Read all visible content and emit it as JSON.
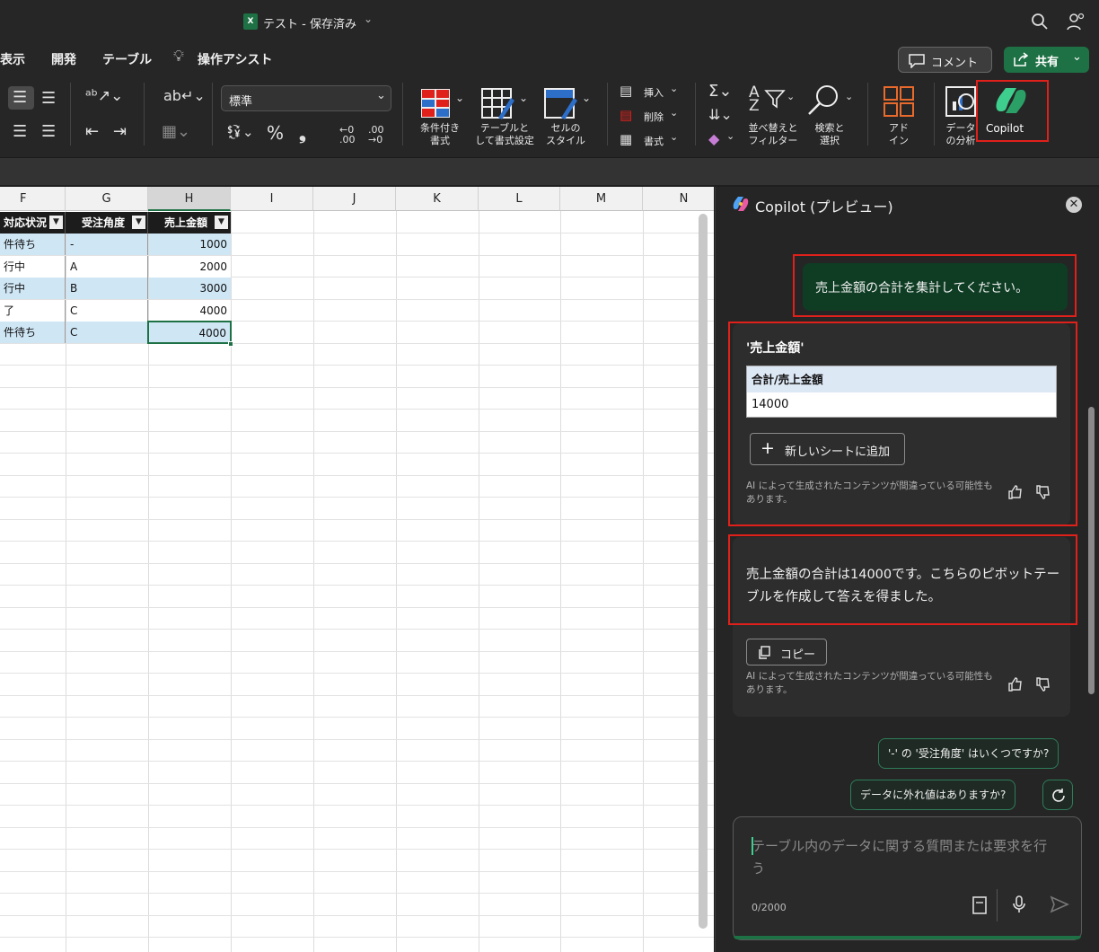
{
  "titlebar": {
    "doc_title": "テスト - 保存済み"
  },
  "menu": {
    "items": [
      "表示",
      "開発",
      "テーブル",
      "操作アシスト"
    ],
    "comment_label": "コメント",
    "share_label": "共有"
  },
  "ribbon": {
    "number_format": "標準",
    "conditional_format": [
      "条件付き",
      "書式"
    ],
    "format_as_table": [
      "テーブルと",
      "して書式設定"
    ],
    "cell_styles": [
      "セルの",
      "スタイル"
    ],
    "insert_label": "挿入",
    "delete_label": "削除",
    "format_label": "書式",
    "sort_filter": [
      "並べ替えと",
      "フィルター"
    ],
    "find_select": [
      "検索と",
      "選択"
    ],
    "addins": [
      "アド",
      "イン"
    ],
    "data_analysis": [
      "データ",
      "の分析"
    ],
    "copilot_label": "Copilot"
  },
  "sheet": {
    "columns": [
      "F",
      "G",
      "H",
      "I",
      "J",
      "K",
      "L",
      "M",
      "N"
    ],
    "headers": {
      "f": "対応状況",
      "g": "受注角度",
      "h": "売上金額"
    },
    "rows": [
      {
        "f": "件待ち",
        "g": "-",
        "h": "1000"
      },
      {
        "f": "行中",
        "g": "A",
        "h": "2000"
      },
      {
        "f": "行中",
        "g": "B",
        "h": "3000"
      },
      {
        "f": "了",
        "g": "C",
        "h": "4000"
      },
      {
        "f": "件待ち",
        "g": "C",
        "h": "4000"
      }
    ]
  },
  "copilot": {
    "title": "Copilot (プレビュー)",
    "user_message": "売上金額の合計を集計してください。",
    "result_title": "'売上金額'",
    "table_header": "合計/売上金額",
    "table_value": "14000",
    "add_sheet_label": "新しいシートに追加",
    "disclaimer": "AI によって生成されたコンテンツが間違っている可能性もあります。",
    "answer_text": "売上金額の合計は14000です。こちらのピボットテーブルを作成して答えを得ました。",
    "copy_label": "コピー",
    "suggestion_1": "'-' の '受注角度' はいくつですか?",
    "suggestion_2": "データに外れ値はありますか?",
    "input_placeholder": "テーブル内のデータに関する質問または要求を行う",
    "char_count": "0/2000"
  },
  "colors": {
    "accent_green": "#1e7145",
    "highlight_red": "#e0201a",
    "table_blue": "#cfe6f5"
  },
  "icons": [
    "excel-icon",
    "search-icon",
    "account-icon",
    "comment-icon",
    "share-icon",
    "copilot-icon",
    "thumbs-up-icon",
    "thumbs-down-icon",
    "copy-icon",
    "refresh-icon",
    "mic-icon",
    "send-icon",
    "notebook-icon",
    "close-icon"
  ]
}
